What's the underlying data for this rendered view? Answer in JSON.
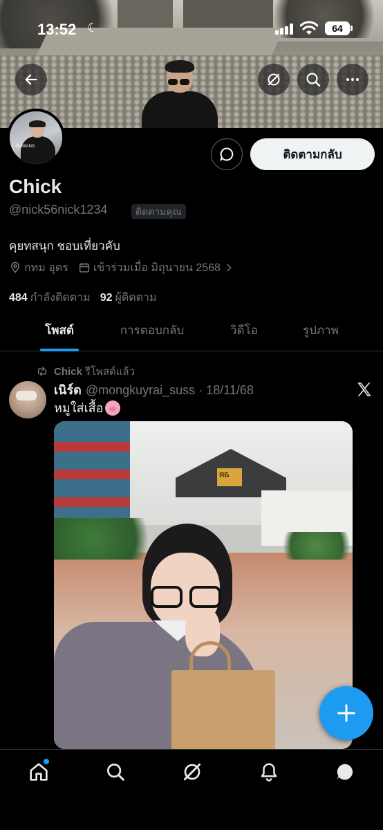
{
  "status_bar": {
    "time": "13:52",
    "battery": "64"
  },
  "profile": {
    "display_name": "Chick",
    "handle": "@nick56nick1234",
    "follows_you_badge": "ติดตามคุณ",
    "bio": "คุยทสนุก ชอบเที่ยวคับ",
    "location": "กทม อุดร",
    "joined": "เข้าร่วมเมื่อ มิถุนายน 2568",
    "following_count": "484",
    "following_label": "กำลังติดตาม",
    "followers_count": "92",
    "followers_label": "ผู้ติดตาม",
    "follow_back_label": "ติดตามกลับ",
    "avatar_text": "RAWANG"
  },
  "tabs": [
    {
      "label": "โพสต์",
      "active": true
    },
    {
      "label": "การตอบกลับ",
      "active": false
    },
    {
      "label": "วิดีโอ",
      "active": false
    },
    {
      "label": "รูปภาพ",
      "active": false
    }
  ],
  "post": {
    "reposted_by": "Chick",
    "reposted_text": "รีโพสต์แล้ว",
    "author_name": "เนิร์ด",
    "author_handle": "@mongkuyrai_suss",
    "date": "· 18/11/68",
    "text": "หมูใส่เสื้อ",
    "image_sign_text": "ЯБ"
  },
  "colors": {
    "accent": "#1d9bf0",
    "background": "#000000",
    "muted": "#71767b",
    "text": "#e7e9ea"
  },
  "icons": [
    "back-arrow-icon",
    "grok-icon",
    "search-icon",
    "more-icon",
    "message-icon",
    "location-icon",
    "calendar-icon",
    "repost-icon",
    "x-logo-icon",
    "plus-icon",
    "home-icon",
    "notifications-icon"
  ]
}
